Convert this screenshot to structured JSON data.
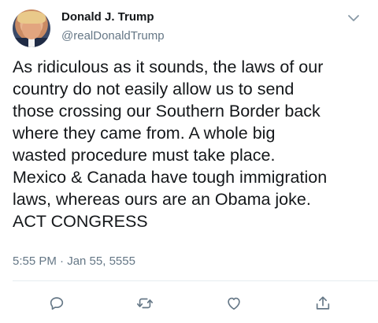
{
  "tweet": {
    "author_name": "Donald J. Trump",
    "author_handle": "@realDonaldTrump",
    "text_lines": [
      "As ridiculous as it sounds, the laws of our",
      "country do not easily allow us to send",
      "those crossing our Southern Border back",
      "where they came from. A whole big",
      "wasted procedure must take place.",
      "Mexico & Canada have tough immigration",
      "laws, whereas ours are an Obama joke.",
      "ACT CONGRESS"
    ],
    "timestamp": "5:55 PM · Jan 55, 5555"
  },
  "icons": {
    "menu": "chevron-down-icon",
    "reply": "reply-icon",
    "retweet": "retweet-icon",
    "like": "heart-icon",
    "share": "share-icon"
  },
  "colors": {
    "text": "#14171a",
    "secondary": "#657786",
    "icon": "#657786",
    "divider": "#e6ecf0"
  }
}
